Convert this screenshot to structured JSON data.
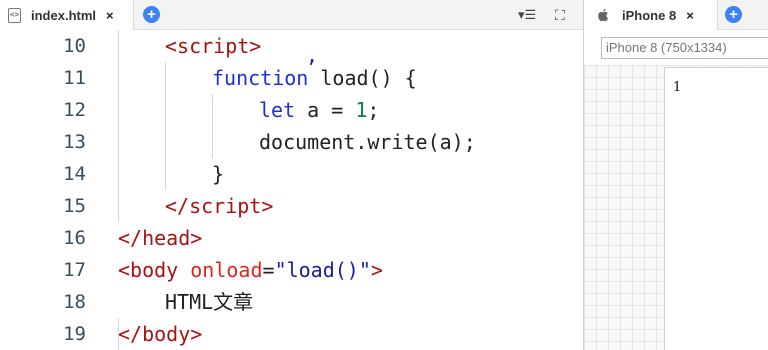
{
  "editor": {
    "tab": {
      "label": "index.html",
      "icon": "html-file-icon",
      "close": "×"
    },
    "add_icon": "+",
    "toolbar": {
      "menu": "▾☰",
      "expand": "⛶"
    },
    "lines": [
      {
        "num": "10",
        "html": "<span class=\"tag\">&lt;script&gt;</span>"
      },
      {
        "num": "11",
        "html": "<span class=\"kw\">function</span> load() {"
      },
      {
        "num": "12",
        "html": "<span class=\"kw\">let</span> a = <span class=\"num\">1</span>;"
      },
      {
        "num": "13",
        "html": "document.write(a);"
      },
      {
        "num": "14",
        "html": "}"
      },
      {
        "num": "15",
        "html": "<span class=\"tag\">&lt;/script&gt;</span>"
      },
      {
        "num": "16",
        "html": "<span class=\"tag\">&lt;/head&gt;</span>"
      },
      {
        "num": "17",
        "html": "<span class=\"tag\">&lt;body</span> <span class=\"attr\">onload</span>=<span class=\"str\">\"load()\"</span><span class=\"tag\">&gt;</span>"
      },
      {
        "num": "18",
        "html": "HTML文章"
      },
      {
        "num": "19",
        "html": "<span class=\"tag\">&lt;/body&gt;</span>"
      }
    ]
  },
  "preview": {
    "tab": {
      "label": "iPhone 8",
      "icon": "apple-icon",
      "close": "×"
    },
    "add_icon": "+",
    "device_select": "iPhone 8 (750x1334)",
    "output": "1"
  },
  "colors": {
    "accent": "#3d82f0",
    "tag": "#aa1111",
    "keyword": "#1f2fd6",
    "string": "#1a1aa6",
    "attribute": "#e0261c",
    "number": "#0b7a5a"
  }
}
